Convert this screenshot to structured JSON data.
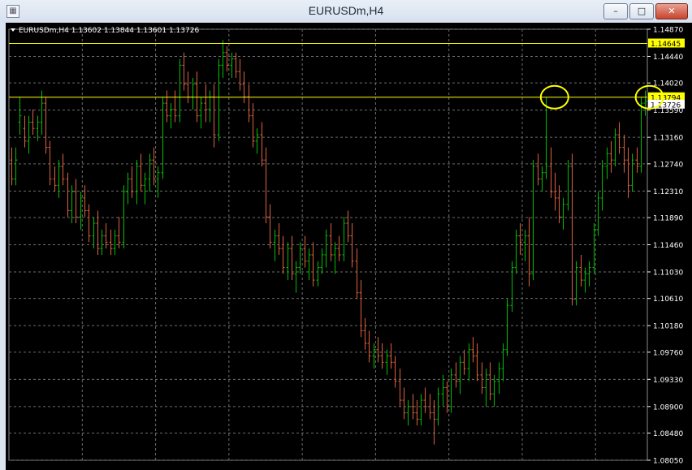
{
  "window": {
    "title": "EURUSDm,H4",
    "minimize_glyph": "–",
    "maximize_glyph": "□",
    "close_glyph": "✕",
    "icon": "chart-window-icon"
  },
  "chart_data": {
    "type": "candlestick",
    "symbol_info": "EURUSDm,H4  1.13602 1.13844 1.13601 1.13726",
    "ylim": [
      1.0805,
      1.1487
    ],
    "y_ticks": [
      "1.14870",
      "1.14440",
      "1.14020",
      "1.13590",
      "1.13160",
      "1.12740",
      "1.12310",
      "1.11890",
      "1.11460",
      "1.11030",
      "1.10610",
      "1.10180",
      "1.09760",
      "1.09330",
      "1.08900",
      "1.08480",
      "1.08050"
    ],
    "price_labels": [
      {
        "value": 1.14645,
        "label": "1.14645",
        "line_color": "#ffff00",
        "box_color": "#ffff00"
      },
      {
        "value": 1.13794,
        "label": "1.13794",
        "line_color": "#ffff00",
        "box_color": "#ffff00"
      },
      {
        "value": 1.13726,
        "label": "1.13726",
        "line_color": "",
        "box_color": "#ffffff"
      }
    ],
    "annotations": [
      {
        "shape": "ellipse",
        "candle_index": 126,
        "price": 1.13794,
        "color": "#ffff00"
      },
      {
        "shape": "ellipse",
        "candle_index": 148,
        "price": 1.13794,
        "color": "#ffff00"
      }
    ],
    "bull_color": "#00c000",
    "bear_color": "#e06040",
    "grid": true,
    "grid_color": "#6e6e6e",
    "background": "#000000",
    "axis_text_color": "#ffffff",
    "candles": [
      [
        1.128,
        1.13,
        1.124,
        1.125
      ],
      [
        1.125,
        1.13,
        1.124,
        1.128
      ],
      [
        1.134,
        1.138,
        1.132,
        1.135
      ],
      [
        1.133,
        1.135,
        1.13,
        1.131
      ],
      [
        1.131,
        1.135,
        1.129,
        1.134
      ],
      [
        1.134,
        1.136,
        1.132,
        1.133
      ],
      [
        1.133,
        1.135,
        1.131,
        1.134
      ],
      [
        1.134,
        1.139,
        1.132,
        1.137
      ],
      [
        1.137,
        1.138,
        1.129,
        1.13
      ],
      [
        1.13,
        1.131,
        1.124,
        1.125
      ],
      [
        1.125,
        1.127,
        1.123,
        1.124
      ],
      [
        1.124,
        1.128,
        1.122,
        1.127
      ],
      [
        1.127,
        1.129,
        1.124,
        1.125
      ],
      [
        1.125,
        1.126,
        1.119,
        1.12
      ],
      [
        1.12,
        1.124,
        1.118,
        1.123
      ],
      [
        1.123,
        1.125,
        1.118,
        1.119
      ],
      [
        1.119,
        1.123,
        1.117,
        1.122
      ],
      [
        1.122,
        1.124,
        1.119,
        1.12
      ],
      [
        1.12,
        1.121,
        1.115,
        1.116
      ],
      [
        1.116,
        1.119,
        1.114,
        1.118
      ],
      [
        1.118,
        1.12,
        1.113,
        1.114
      ],
      [
        1.114,
        1.117,
        1.113,
        1.116
      ],
      [
        1.116,
        1.118,
        1.114,
        1.115
      ],
      [
        1.115,
        1.117,
        1.113,
        1.114
      ],
      [
        1.114,
        1.117,
        1.113,
        1.116
      ],
      [
        1.116,
        1.119,
        1.114,
        1.115
      ],
      [
        1.115,
        1.124,
        1.114,
        1.123
      ],
      [
        1.123,
        1.126,
        1.121,
        1.125
      ],
      [
        1.125,
        1.127,
        1.122,
        1.123
      ],
      [
        1.123,
        1.128,
        1.121,
        1.127
      ],
      [
        1.127,
        1.129,
        1.123,
        1.124
      ],
      [
        1.124,
        1.126,
        1.121,
        1.125
      ],
      [
        1.125,
        1.129,
        1.123,
        1.128
      ],
      [
        1.128,
        1.13,
        1.124,
        1.125
      ],
      [
        1.125,
        1.127,
        1.122,
        1.126
      ],
      [
        1.126,
        1.138,
        1.125,
        1.137
      ],
      [
        1.137,
        1.139,
        1.134,
        1.135
      ],
      [
        1.135,
        1.137,
        1.133,
        1.136
      ],
      [
        1.136,
        1.139,
        1.134,
        1.135
      ],
      [
        1.135,
        1.144,
        1.134,
        1.143
      ],
      [
        1.143,
        1.145,
        1.139,
        1.14
      ],
      [
        1.14,
        1.142,
        1.137,
        1.138
      ],
      [
        1.138,
        1.141,
        1.136,
        1.14
      ],
      [
        1.14,
        1.142,
        1.134,
        1.135
      ],
      [
        1.135,
        1.138,
        1.133,
        1.137
      ],
      [
        1.137,
        1.14,
        1.134,
        1.136
      ],
      [
        1.136,
        1.139,
        1.134,
        1.138
      ],
      [
        1.138,
        1.14,
        1.13,
        1.132
      ],
      [
        1.132,
        1.144,
        1.131,
        1.143
      ],
      [
        1.143,
        1.147,
        1.141,
        1.145
      ],
      [
        1.145,
        1.146,
        1.142,
        1.143
      ],
      [
        1.143,
        1.145,
        1.141,
        1.144
      ],
      [
        1.144,
        1.145,
        1.141,
        1.142
      ],
      [
        1.142,
        1.144,
        1.139,
        1.14
      ],
      [
        1.14,
        1.142,
        1.137,
        1.138
      ],
      [
        1.138,
        1.14,
        1.134,
        1.135
      ],
      [
        1.135,
        1.137,
        1.13,
        1.131
      ],
      [
        1.131,
        1.133,
        1.129,
        1.132
      ],
      [
        1.132,
        1.134,
        1.127,
        1.128
      ],
      [
        1.128,
        1.13,
        1.118,
        1.119
      ],
      [
        1.119,
        1.121,
        1.114,
        1.115
      ],
      [
        1.115,
        1.117,
        1.112,
        1.116
      ],
      [
        1.116,
        1.118,
        1.113,
        1.114
      ],
      [
        1.114,
        1.116,
        1.11,
        1.111
      ],
      [
        1.111,
        1.115,
        1.109,
        1.114
      ],
      [
        1.114,
        1.116,
        1.109,
        1.11
      ],
      [
        1.11,
        1.112,
        1.107,
        1.111
      ],
      [
        1.111,
        1.115,
        1.11,
        1.114
      ],
      [
        1.114,
        1.116,
        1.111,
        1.112
      ],
      [
        1.112,
        1.114,
        1.109,
        1.113
      ],
      [
        1.113,
        1.115,
        1.108,
        1.109
      ],
      [
        1.109,
        1.112,
        1.108,
        1.111
      ],
      [
        1.111,
        1.114,
        1.11,
        1.113
      ],
      [
        1.113,
        1.117,
        1.111,
        1.116
      ],
      [
        1.116,
        1.118,
        1.112,
        1.113
      ],
      [
        1.113,
        1.115,
        1.11,
        1.114
      ],
      [
        1.114,
        1.116,
        1.112,
        1.113
      ],
      [
        1.113,
        1.119,
        1.112,
        1.118
      ],
      [
        1.118,
        1.12,
        1.115,
        1.116
      ],
      [
        1.116,
        1.118,
        1.111,
        1.112
      ],
      [
        1.112,
        1.114,
        1.106,
        1.107
      ],
      [
        1.107,
        1.109,
        1.1,
        1.101
      ],
      [
        1.101,
        1.103,
        1.098,
        1.099
      ],
      [
        1.099,
        1.101,
        1.096,
        1.097
      ],
      [
        1.097,
        1.099,
        1.095,
        1.098
      ],
      [
        1.098,
        1.1,
        1.096,
        1.097
      ],
      [
        1.097,
        1.099,
        1.095,
        1.096
      ],
      [
        1.096,
        1.098,
        1.094,
        1.097
      ],
      [
        1.097,
        1.099,
        1.095,
        1.096
      ],
      [
        1.096,
        1.097,
        1.092,
        1.093
      ],
      [
        1.093,
        1.095,
        1.089,
        1.09
      ],
      [
        1.09,
        1.092,
        1.087,
        1.088
      ],
      [
        1.088,
        1.09,
        1.086,
        1.089
      ],
      [
        1.089,
        1.091,
        1.087,
        1.088
      ],
      [
        1.088,
        1.09,
        1.086,
        1.087
      ],
      [
        1.087,
        1.091,
        1.086,
        1.09
      ],
      [
        1.09,
        1.092,
        1.088,
        1.089
      ],
      [
        1.089,
        1.091,
        1.087,
        1.088
      ],
      [
        1.088,
        1.09,
        1.083,
        1.087
      ],
      [
        1.087,
        1.092,
        1.086,
        1.091
      ],
      [
        1.091,
        1.094,
        1.089,
        1.092
      ],
      [
        1.092,
        1.093,
        1.088,
        1.089
      ],
      [
        1.089,
        1.095,
        1.088,
        1.094
      ],
      [
        1.094,
        1.096,
        1.092,
        1.093
      ],
      [
        1.093,
        1.097,
        1.091,
        1.096
      ],
      [
        1.096,
        1.098,
        1.094,
        1.095
      ],
      [
        1.095,
        1.099,
        1.093,
        1.098
      ],
      [
        1.098,
        1.1,
        1.096,
        1.097
      ],
      [
        1.097,
        1.099,
        1.093,
        1.094
      ],
      [
        1.094,
        1.096,
        1.091,
        1.092
      ],
      [
        1.092,
        1.095,
        1.089,
        1.094
      ],
      [
        1.094,
        1.096,
        1.09,
        1.091
      ],
      [
        1.091,
        1.094,
        1.089,
        1.093
      ],
      [
        1.093,
        1.096,
        1.091,
        1.095
      ],
      [
        1.095,
        1.099,
        1.093,
        1.098
      ],
      [
        1.098,
        1.106,
        1.097,
        1.105
      ],
      [
        1.105,
        1.112,
        1.104,
        1.111
      ],
      [
        1.111,
        1.117,
        1.11,
        1.116
      ],
      [
        1.116,
        1.118,
        1.113,
        1.115
      ],
      [
        1.115,
        1.117,
        1.112,
        1.116
      ],
      [
        1.116,
        1.119,
        1.108,
        1.11
      ],
      [
        1.11,
        1.128,
        1.109,
        1.127
      ],
      [
        1.127,
        1.129,
        1.124,
        1.125
      ],
      [
        1.125,
        1.127,
        1.123,
        1.126
      ],
      [
        1.126,
        1.138,
        1.125,
        1.127
      ],
      [
        1.127,
        1.13,
        1.122,
        1.123
      ],
      [
        1.123,
        1.126,
        1.12,
        1.122
      ],
      [
        1.122,
        1.124,
        1.118,
        1.119
      ],
      [
        1.119,
        1.122,
        1.117,
        1.121
      ],
      [
        1.121,
        1.128,
        1.12,
        1.127
      ],
      [
        1.127,
        1.129,
        1.105,
        1.106
      ],
      [
        1.106,
        1.112,
        1.105,
        1.111
      ],
      [
        1.111,
        1.113,
        1.108,
        1.109
      ],
      [
        1.109,
        1.111,
        1.107,
        1.11
      ],
      [
        1.11,
        1.112,
        1.108,
        1.111
      ],
      [
        1.111,
        1.118,
        1.11,
        1.117
      ],
      [
        1.117,
        1.123,
        1.116,
        1.122
      ],
      [
        1.122,
        1.128,
        1.12,
        1.127
      ],
      [
        1.127,
        1.13,
        1.125,
        1.129
      ],
      [
        1.129,
        1.131,
        1.126,
        1.128
      ],
      [
        1.128,
        1.133,
        1.127,
        1.132
      ],
      [
        1.132,
        1.134,
        1.129,
        1.13
      ],
      [
        1.13,
        1.132,
        1.126,
        1.128
      ],
      [
        1.128,
        1.13,
        1.122,
        1.124
      ],
      [
        1.124,
        1.129,
        1.123,
        1.128
      ],
      [
        1.128,
        1.13,
        1.126,
        1.127
      ],
      [
        1.127,
        1.138,
        1.126,
        1.137
      ],
      [
        1.137,
        1.139,
        1.135,
        1.1373
      ]
    ]
  }
}
